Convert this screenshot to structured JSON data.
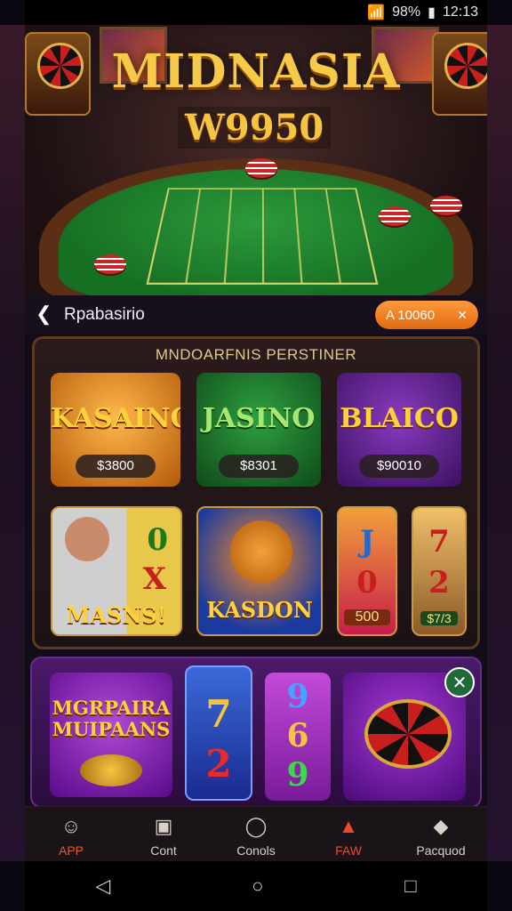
{
  "status_bar": {
    "battery": "98%",
    "time": "12:13"
  },
  "hero": {
    "title": "MIDNASIA",
    "subtitle": "W9950"
  },
  "nav": {
    "back_icon": "chevron-left",
    "title": "Rpabasirio",
    "pill_label": "A 10060",
    "pill_icon": "close"
  },
  "panel": {
    "header": "MNDOARFNIS PERSTINER",
    "featured": [
      {
        "title": "KASAINO",
        "price": "$3800",
        "bg": "#d88a1a"
      },
      {
        "title": "JASINO",
        "price": "$8301",
        "bg": "#1f6a2a"
      },
      {
        "title": "BLAICO",
        "price": "$90010",
        "bg": "#5a2a8a"
      }
    ],
    "row2": [
      {
        "title": "MASNS!",
        "symbols": [
          "0",
          "X"
        ]
      },
      {
        "title": "KASDON"
      },
      {
        "reel": [
          "J",
          "0"
        ],
        "label": "500"
      },
      {
        "reel": [
          "7",
          "2"
        ],
        "label": "$7/3"
      }
    ]
  },
  "bottom_panel": {
    "cards": [
      {
        "title": "MGRPAIRA MUIPAANS"
      },
      {
        "reel": [
          "7",
          "2"
        ]
      },
      {
        "reel": [
          "9",
          "6",
          "9"
        ]
      },
      {
        "title": "ROULETTE"
      }
    ],
    "close_icon": "close"
  },
  "tabs": [
    {
      "label": "APP",
      "icon": "avatar"
    },
    {
      "label": "Cont",
      "icon": "box"
    },
    {
      "label": "Conols",
      "icon": "chat"
    },
    {
      "label": "FAW",
      "icon": "fire"
    },
    {
      "label": "Pacquod",
      "icon": "cat"
    }
  ],
  "sysnav": {
    "back": "◁",
    "home": "○",
    "recent": "□"
  }
}
